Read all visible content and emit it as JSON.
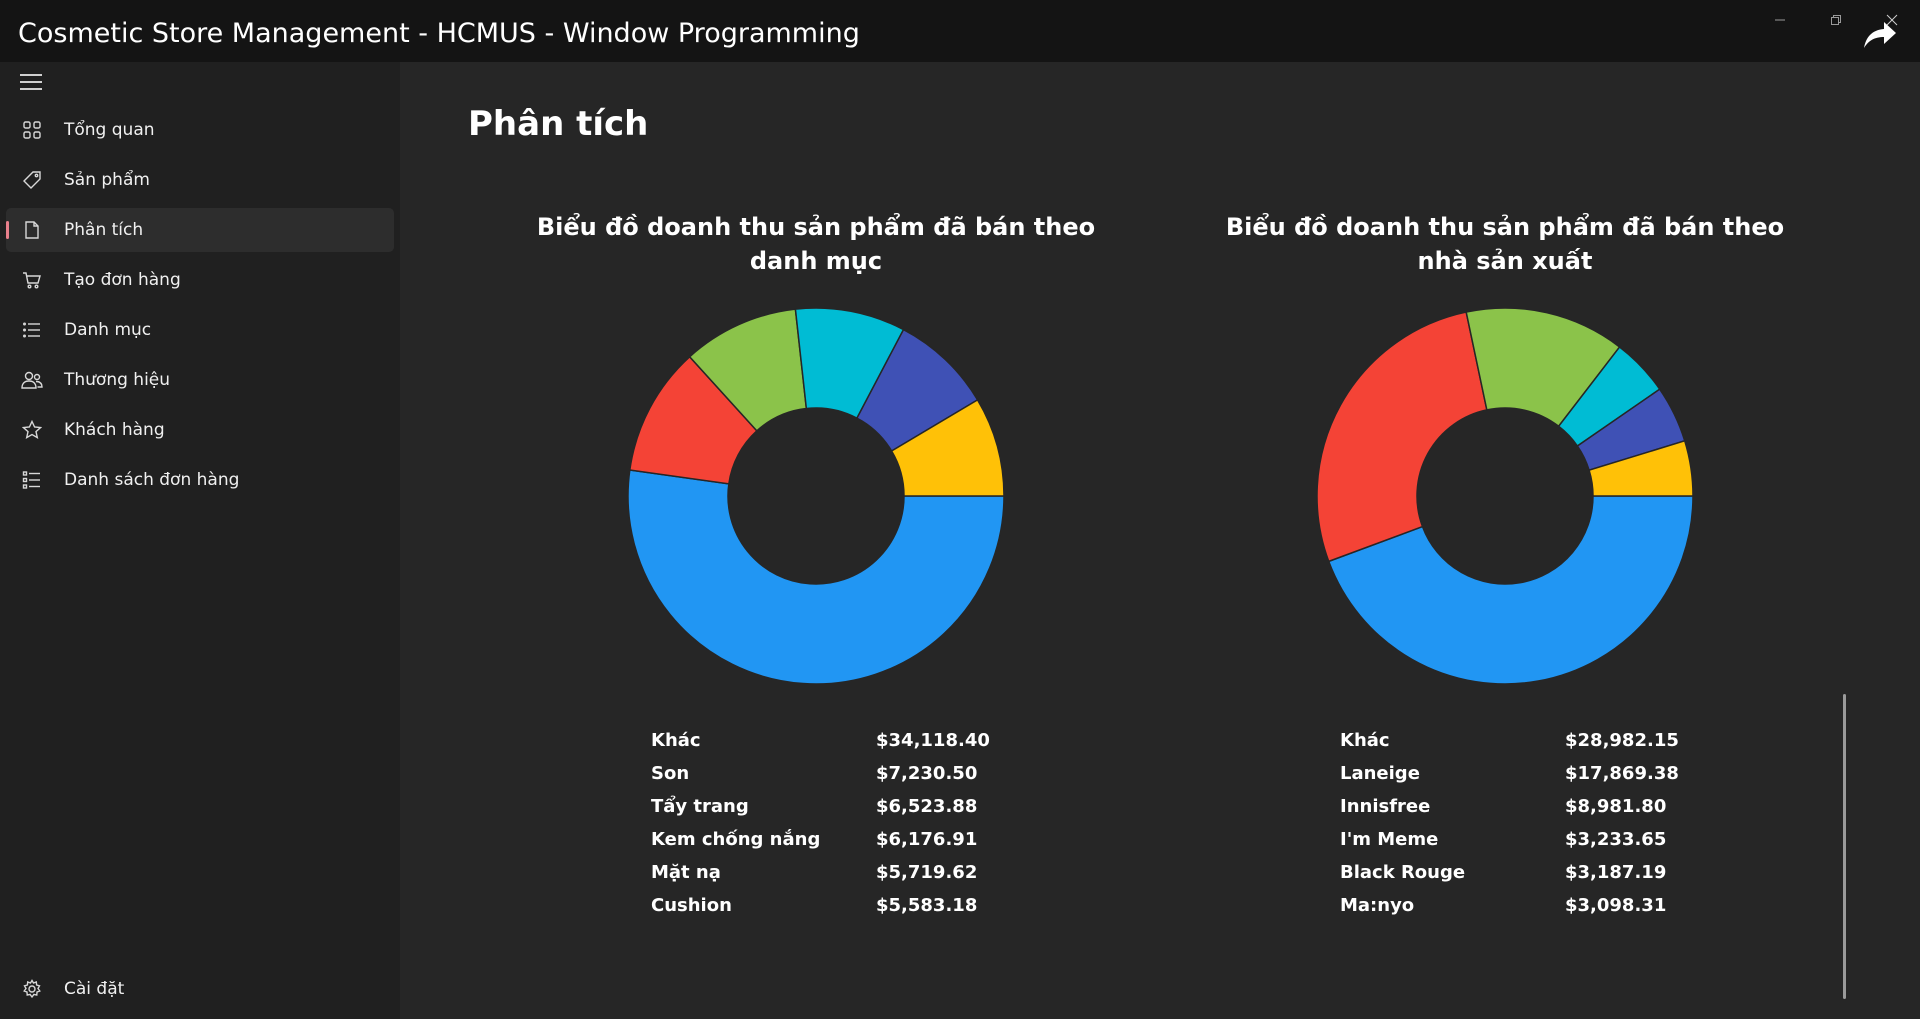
{
  "window": {
    "title": "Cosmetic Store Management - HCMUS - Window Programming",
    "controls": [
      "minimize",
      "restore",
      "close"
    ]
  },
  "sidebar": {
    "items": [
      {
        "label": "Tổng quan",
        "icon": "grid-icon",
        "active": false
      },
      {
        "label": "Sản phẩm",
        "icon": "tag-icon",
        "active": false
      },
      {
        "label": "Phân tích",
        "icon": "document-icon",
        "active": true
      },
      {
        "label": "Tạo đơn hàng",
        "icon": "cart-icon",
        "active": false
      },
      {
        "label": "Danh mục",
        "icon": "list-icon",
        "active": false
      },
      {
        "label": "Thương hiệu",
        "icon": "people-icon",
        "active": false
      },
      {
        "label": "Khách hàng",
        "icon": "star-icon",
        "active": false
      },
      {
        "label": "Danh sách đơn hàng",
        "icon": "ordered-list-icon",
        "active": false
      }
    ],
    "settings": {
      "label": "Cài đặt",
      "icon": "gear-icon"
    }
  },
  "main": {
    "page_title": "Phân tích"
  },
  "chart_data": [
    {
      "type": "pie",
      "title_line1": "Biểu đồ doanh thu sản phẩm đã bán theo",
      "title_line2": "danh mục",
      "categories": [
        "Khác",
        "Son",
        "Tẩy trang",
        "Kem chống nắng",
        "Mặt nạ",
        "Cushion"
      ],
      "values": [
        34118.4,
        7230.5,
        6523.88,
        6176.91,
        5719.62,
        5583.18
      ],
      "value_labels": [
        "$34,118.40",
        "$7,230.50",
        "$6,523.88",
        "$6,176.91",
        "$5,719.62",
        "$5,583.18"
      ],
      "colors": [
        "#2196f3",
        "#f44336",
        "#8bc34a",
        "#00bcd4",
        "#3f51b5",
        "#ffc107"
      ],
      "donut": true
    },
    {
      "type": "pie",
      "title_line1": "Biểu đồ doanh thu sản phẩm đã bán theo",
      "title_line2": "nhà sản xuất",
      "categories": [
        "Khác",
        "Laneige",
        "Innisfree",
        "I'm Meme",
        "Black Rouge",
        "Ma:nyo"
      ],
      "values": [
        28982.15,
        17869.38,
        8981.8,
        3233.65,
        3187.19,
        3098.31
      ],
      "value_labels": [
        "$28,982.15",
        "$17,869.38",
        "$8,981.80",
        "$3,233.65",
        "$3,187.19",
        "$3,098.31"
      ],
      "colors": [
        "#2196f3",
        "#f44336",
        "#8bc34a",
        "#00bcd4",
        "#3f51b5",
        "#ffc107"
      ],
      "donut": true
    }
  ]
}
